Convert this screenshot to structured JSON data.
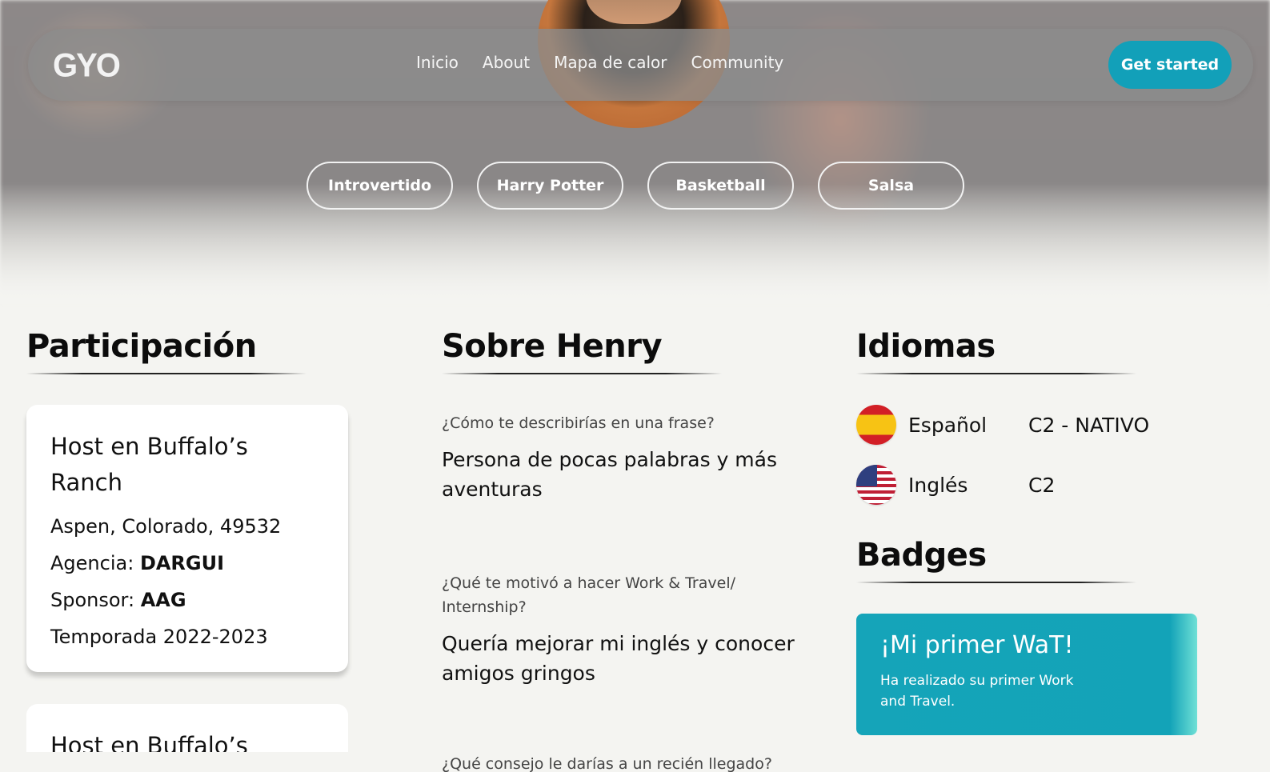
{
  "nav": {
    "logo": "GYO",
    "links": [
      "Inicio",
      "About",
      "Mapa de calor",
      "Community"
    ],
    "cta": "Get started"
  },
  "interests": [
    "Introvertido",
    "Harry Potter",
    "Basketball",
    "Salsa"
  ],
  "participacion": {
    "heading": "Participación",
    "cards": [
      {
        "title": "Host en Buffalo’s Ranch",
        "location": "Aspen, Colorado, 49532",
        "agency_label": "Agencia:",
        "agency": "DARGUI",
        "sponsor_label": "Sponsor:",
        "sponsor": "AAG",
        "season": "Temporada 2022-2023"
      },
      {
        "title": "Host en Buffalo’s"
      }
    ]
  },
  "sobre": {
    "heading": "Sobre Henry",
    "qa": [
      {
        "q": "¿Cómo te describirías en una frase?",
        "a": "Persona de pocas palabras y más aventuras"
      },
      {
        "q": "¿Qué te motivó a hacer Work & Travel/ Internship?",
        "a": "Quería mejorar mi inglés y conocer amigos gringos"
      },
      {
        "q": "¿Qué consejo le darías a un recién llegado?",
        "a": ""
      }
    ]
  },
  "idiomas": {
    "heading": "Idiomas",
    "languages": [
      {
        "name": "Español",
        "level": "C2 - NATIVO",
        "flag": "spain-flag-icon"
      },
      {
        "name": "Inglés",
        "level": "C2",
        "flag": "usa-flag-icon"
      }
    ]
  },
  "badges": {
    "heading": "Badges",
    "items": [
      {
        "title": "¡Mi primer WaT!",
        "description": "Ha realizado su primer Work and Travel."
      }
    ]
  },
  "colors": {
    "accent": "#12a0b9",
    "background": "#f4f4f1"
  }
}
